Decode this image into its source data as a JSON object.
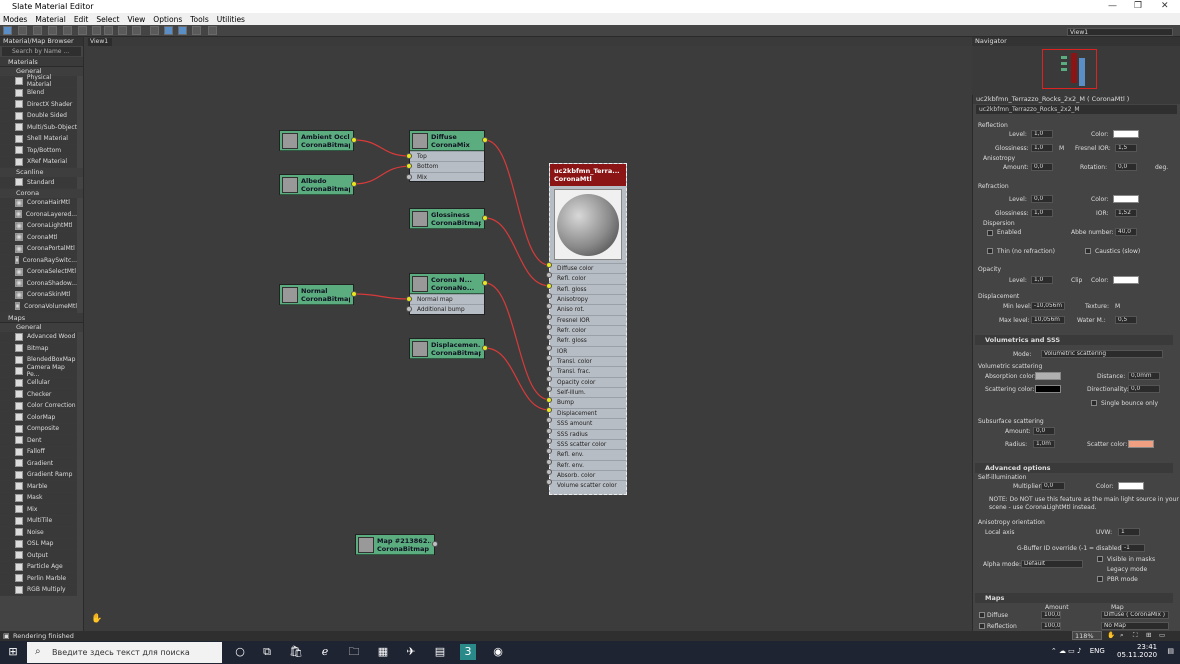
{
  "window": {
    "title": "Slate Material Editor"
  },
  "menu": [
    "Modes",
    "Material",
    "Edit",
    "Select",
    "View",
    "Options",
    "Tools",
    "Utilities"
  ],
  "browser": {
    "title": "Material/Map Browser",
    "search_placeholder": "Search by Name ...",
    "sections": [
      {
        "label": "Materials",
        "groups": [
          {
            "label": "General",
            "items": [
              "Physical Material",
              "Blend",
              "DirectX Shader",
              "Double Sided",
              "Multi/Sub-Object",
              "Shell Material",
              "Top/Bottom",
              "XRef Material"
            ]
          },
          {
            "label": "Scanline",
            "items": [
              "Standard"
            ]
          },
          {
            "label": "Corona",
            "items": [
              "CoronaHairMtl",
              "CoronaLayered...",
              "CoronaLightMtl",
              "CoronaMtl",
              "CoronaPortalMtl",
              "CoronaRaySwitc...",
              "CoronaSelectMtl",
              "CoronaShadow...",
              "CoronaSkinMtl",
              "CoronaVolumeMtl"
            ]
          }
        ]
      },
      {
        "label": "Maps",
        "groups": [
          {
            "label": "General",
            "items": [
              "Advanced Wood",
              "Bitmap",
              "BlendedBoxMap",
              "Camera Map Pe...",
              "Cellular",
              "Checker",
              "Color Correction",
              "ColorMap",
              "Composite",
              "Dent",
              "Falloff",
              "Gradient",
              "Gradient Ramp",
              "Marble",
              "Mask",
              "Mix",
              "MultiTile",
              "Noise",
              "OSL Map",
              "Output",
              "Particle Age",
              "Perlin Marble",
              "RGB Multiply"
            ]
          }
        ]
      }
    ]
  },
  "view": {
    "tab": "View1",
    "dropdown": "View1"
  },
  "nodes": [
    {
      "id": "ao",
      "t1": "Ambient Occl...",
      "t2": "CoronaBitmap"
    },
    {
      "id": "albedo",
      "t1": "Albedo",
      "t2": "CoronaBitmap"
    },
    {
      "id": "diffuse",
      "t1": "Diffuse",
      "t2": "CoronaMix",
      "slots": [
        "Top",
        "Bottom",
        "Mix"
      ]
    },
    {
      "id": "gloss",
      "t1": "Glossiness",
      "t2": "CoronaBitmap"
    },
    {
      "id": "normal",
      "t1": "Normal",
      "t2": "CoronaBitmap"
    },
    {
      "id": "coronan",
      "t1": "Corona N...",
      "t2": "CoronaNo...",
      "slots": [
        "Normal map",
        "Additional bump"
      ]
    },
    {
      "id": "disp",
      "t1": "Displacemen...",
      "t2": "CoronaBitmap"
    },
    {
      "id": "map",
      "t1": "Map #213862...",
      "t2": "CoronaBitmap"
    }
  ],
  "material": {
    "t1": "uc2kbfmn_Terra...",
    "t2": "CoronaMtl",
    "slots": [
      "Diffuse color",
      "Refl. color",
      "Refl. gloss",
      "Anisotropy",
      "Aniso rot.",
      "Fresnel IOR",
      "Refr. color",
      "Refr. gloss",
      "IOR",
      "Transl. color",
      "Transl. frac.",
      "Opacity color",
      "Self-illum.",
      "Bump",
      "Displacement",
      "SSS amount",
      "SSS radius",
      "SSS scatter color",
      "Refl. env.",
      "Refr. env.",
      "Absorb. color",
      "Volume scatter color"
    ]
  },
  "navigator": {
    "title": "Navigator"
  },
  "props": {
    "name": "uc2kbfmn_Terrazzo_Rocks_2x2_M  ( CoronaMtl )",
    "name2": "uc2kbfmn_Terrazzo_Rocks_2x2_M",
    "reflection": "Reflection",
    "level": "Level:",
    "color": "Color:",
    "glossiness": "Glossiness:",
    "fresnel": "Fresnel IOR:",
    "anisotropy": "Anisotropy",
    "amount": "Amount:",
    "rotation": "Rotation:",
    "deg": "deg.",
    "M": "M",
    "refl_level": "1,0",
    "refl_gloss": "1,0",
    "fresnel_val": "1,5",
    "aniso_amount": "0,0",
    "aniso_rot": "0,0",
    "refraction": "Refraction",
    "refr_level": "0,0",
    "refr_gloss": "1,0",
    "ior_label": "IOR:",
    "ior_val": "1,52",
    "dispersion": "Dispersion",
    "enabled": "Enabled",
    "abbe": "Abbe number:",
    "abbe_val": "40,0",
    "thin": "Thin (no refraction)",
    "caustics": "Caustics (slow)",
    "opacity": "Opacity",
    "op_level": "1,0",
    "clip": "Clip",
    "displacement": "Displacement",
    "min_level": "Min level:",
    "min_val": "-10,056m",
    "texture": "Texture:",
    "max_level": "Max level:",
    "max_val": "10,056m",
    "water": "Water M.:",
    "water_val": "0,5",
    "vol_title": "Volumetrics and SSS",
    "mode": "Mode:",
    "mode_val": "Volumetric scattering",
    "vol_scat": "Volumetric scattering",
    "absorption": "Absorption color:",
    "distance": "Distance:",
    "distance_val": "0,0mm",
    "scattering": "Scattering color:",
    "direction": "Directionality:",
    "direction_val": "0,0",
    "single": "Single bounce only",
    "sss": "Subsurface scattering",
    "sss_amount_val": "0,0",
    "radius": "Radius:",
    "radius_val": "1,0m",
    "scatter": "Scatter color:",
    "adv_title": "Advanced options",
    "selfillum": "Self-illumination",
    "multiplier": "Multiplier:",
    "mult_val": "0,0",
    "note1": "NOTE: Do NOT use this feature as the main light source in your",
    "note2": "scene - use CoronaLightMtl instead.",
    "aniso_orient": "Anisotropy orientation",
    "local": "Local axis",
    "uvw": "UVW:",
    "uvw_val": "1",
    "gbuffer": "G-Buffer ID override (-1 = disabled):",
    "gbuffer_val": "-1",
    "visible": "Visible in masks",
    "legacy": "Legacy mode",
    "alpha": "Alpha mode:",
    "alpha_val": "Default",
    "pbr": "PBR mode",
    "maps_title": "Maps",
    "amount_col": "Amount",
    "map_col": "Map",
    "m_diffuse": "Diffuse",
    "m_diffuse_amt": "100,0",
    "m_diffuse_map": "Diffuse  ( CoronaMix )",
    "m_refl": "Reflection",
    "m_refl_amt": "100,0",
    "m_refl_map": "No Map"
  },
  "status": {
    "text": "Rendering finished",
    "zoom": "118%"
  },
  "taskbar": {
    "search": "Введите здесь текст для поиска",
    "lang": "ENG",
    "time": "23:41",
    "date": "05.11.2020"
  },
  "colors": {
    "node_header": "#5bad7f",
    "material_header": "#8b1414",
    "scatter": "#f0a080"
  }
}
